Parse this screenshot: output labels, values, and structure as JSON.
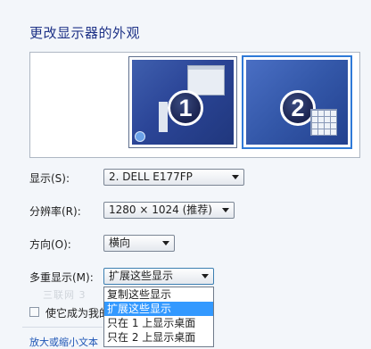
{
  "page": {
    "title": "更改显示器的外观"
  },
  "preview": {
    "monitors": [
      {
        "number": "1",
        "selected": false
      },
      {
        "number": "2",
        "selected": true
      }
    ]
  },
  "form": {
    "display": {
      "label": "显示(S):",
      "value": "2. DELL E177FP"
    },
    "resolution": {
      "label": "分辨率(R):",
      "value": "1280 × 1024 (推荐)"
    },
    "orientation": {
      "label": "方向(O):",
      "value": "横向"
    },
    "multiple_displays": {
      "label": "多重显示(M):",
      "value": "扩展这些显示",
      "options": [
        {
          "label": "复制这些显示",
          "selected": false
        },
        {
          "label": "扩展这些显示",
          "selected": true
        },
        {
          "label": "只在 1 上显示桌面",
          "selected": false
        },
        {
          "label": "只在 2 上显示桌面",
          "selected": false
        }
      ]
    }
  },
  "checkbox": {
    "label": "使它成为我的",
    "checked": false
  },
  "link": {
    "label": "放大或缩小文本"
  },
  "watermark": {
    "text": "三联网 3"
  },
  "colors": {
    "accent": "#3399ff",
    "title": "#1e3287",
    "link": "#1f56b6"
  }
}
